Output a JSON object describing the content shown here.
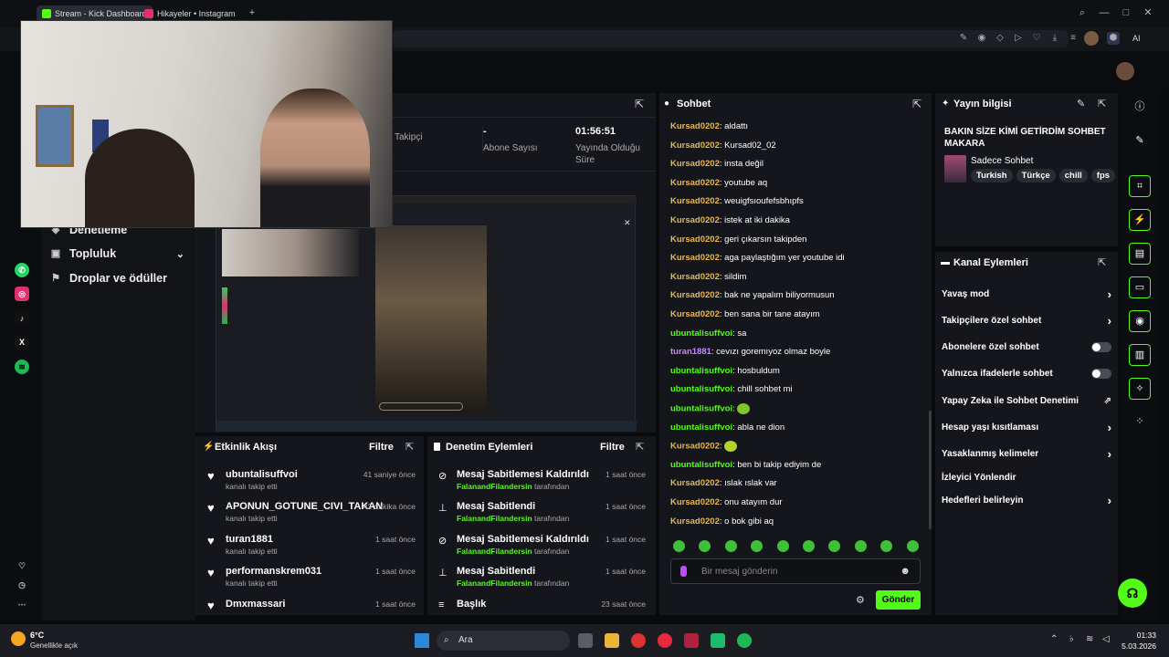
{
  "browser": {
    "tabs": [
      "Stream - Kick Dashboard",
      "Hikayeler • Instagram"
    ],
    "ai_label": "AI"
  },
  "sidebar": {
    "items": [
      {
        "label": "Denetleme"
      },
      {
        "label": "Topluluk"
      },
      {
        "label": "Droplar ve ödüller"
      }
    ]
  },
  "stats": [
    {
      "value": "",
      "label": "Takipçi"
    },
    {
      "value": "-",
      "label": "Abone Sayısı"
    },
    {
      "value": "01:56:51",
      "label": "Yayında Olduğu Süre"
    }
  ],
  "activity": {
    "title": "Etkinlik Akışı",
    "filter": "Filtre",
    "items": [
      {
        "name": "ubuntalisuffvoi",
        "action": "kanalı takip etti",
        "time": "41 saniye önce"
      },
      {
        "name": "APONUN_GOTUNE_CIVI_TAKAN",
        "action": "kanalı takip etti",
        "time": "42 dakika önce"
      },
      {
        "name": "turan1881",
        "action": "kanalı takip etti",
        "time": "1 saat önce"
      },
      {
        "name": "performanskrem031",
        "action": "kanalı takip etti",
        "time": "1 saat önce"
      },
      {
        "name": "Dmxmassari",
        "action": "",
        "time": "1 saat önce"
      }
    ]
  },
  "moderation": {
    "title": "Denetim Eylemleri",
    "filter": "Filtre",
    "items": [
      {
        "title": "Mesaj Sabitlemesi Kaldırıldı",
        "by": "FalanandFilandersin",
        "suffix": "tarafından",
        "time": "1 saat önce"
      },
      {
        "title": "Mesaj Sabitlendi",
        "by": "FalanandFilandersin",
        "suffix": "tarafından",
        "time": "1 saat önce"
      },
      {
        "title": "Mesaj Sabitlemesi Kaldırıldı",
        "by": "FalanandFilandersin",
        "suffix": "tarafından",
        "time": "1 saat önce"
      },
      {
        "title": "Mesaj Sabitlendi",
        "by": "FalanandFilandersin",
        "suffix": "tarafından",
        "time": "1 saat önce"
      },
      {
        "title": "Başlık",
        "by": "",
        "suffix": "",
        "time": "23 saat önce"
      }
    ]
  },
  "chat": {
    "title": "Sohbet",
    "placeholder": "Bir mesaj gönderin",
    "send": "Gönder",
    "messages": [
      {
        "user": "Kursad0202",
        "text": "aldattı",
        "role": "k"
      },
      {
        "user": "Kursad0202",
        "text": "Kursad02_02",
        "role": "k"
      },
      {
        "user": "Kursad0202",
        "text": "insta değil",
        "role": "k"
      },
      {
        "user": "Kursad0202",
        "text": "youtube aq",
        "role": "k"
      },
      {
        "user": "Kursad0202",
        "text": "weuigfsıoufefsbhıpfs",
        "role": "k"
      },
      {
        "user": "Kursad0202",
        "text": "istek at iki dakika",
        "role": "k"
      },
      {
        "user": "Kursad0202",
        "text": "geri çıkarsın takipden",
        "role": "k"
      },
      {
        "user": "Kursad0202",
        "text": "aga paylaştığım yer youtube idi",
        "role": "k"
      },
      {
        "user": "Kursad0202",
        "text": "sildim",
        "role": "k"
      },
      {
        "user": "Kursad0202",
        "text": "bak ne yapalım biliyormusun",
        "role": "k"
      },
      {
        "user": "Kursad0202",
        "text": "ben sana bir tane atayım",
        "role": "k"
      },
      {
        "user": "ubuntalisuffvoi",
        "text": "sa",
        "role": "u"
      },
      {
        "user": "turan1881",
        "text": "cevızı goremıyoz olmaz boyle",
        "role": "t"
      },
      {
        "user": "ubuntalisuffvoi",
        "text": "hosbuldum",
        "role": "u"
      },
      {
        "user": "ubuntalisuffvoi",
        "text": "chill sohbet mi",
        "role": "u"
      },
      {
        "user": "ubuntalisuffvoi",
        "text": "",
        "role": "u",
        "emoji": true
      },
      {
        "user": "ubuntalisuffvoi",
        "text": "abla ne dion",
        "role": "u"
      },
      {
        "user": "Kursad0202",
        "text": "",
        "role": "k",
        "emoji": true
      },
      {
        "user": "ubuntalisuffvoi",
        "text": "ben bi takip ediyim de",
        "role": "u"
      },
      {
        "user": "Kursad0202",
        "text": "ıslak ıslak var",
        "role": "k"
      },
      {
        "user": "Kursad0202",
        "text": "onu atayım dur",
        "role": "k"
      },
      {
        "user": "Kursad0202",
        "text": "o bok gibi aq",
        "role": "k"
      }
    ]
  },
  "stream_info": {
    "title": "Yayın bilgisi",
    "stream_title": "BAKIN SİZE KİMİ GETİRDİM SOHBET MAKARA",
    "category": "Sadece Sohbet",
    "tags": [
      "Turkish",
      "Türkçe",
      "chill",
      "fps"
    ]
  },
  "channel_actions": {
    "title": "Kanal Eylemleri",
    "items": [
      {
        "label": "Yavaş mod",
        "control": "chevron"
      },
      {
        "label": "Takipçilere özel sohbet",
        "control": "chevron"
      },
      {
        "label": "Abonelere özel sohbet",
        "control": "toggle"
      },
      {
        "label": "Yalnızca ifadelerle sohbet",
        "control": "toggle"
      },
      {
        "label": "Yapay Zeka ile Sohbet Denetimi",
        "control": "external"
      },
      {
        "label": "Hesap yaşı kısıtlaması",
        "control": "chevron"
      },
      {
        "label": "Yasaklanmış kelimeler",
        "control": "chevron"
      },
      {
        "label": "İzleyici Yönlendir",
        "control": "none"
      },
      {
        "label": "Hedefleri belirleyin",
        "control": "chevron"
      }
    ]
  },
  "taskbar": {
    "weather_temp": "6°C",
    "weather_desc": "Genellikle açık",
    "search": "Ara",
    "time": "01:33",
    "date": "5.03.2026"
  },
  "colors": {
    "accent": "#53fc18",
    "panel": "#15161b"
  }
}
